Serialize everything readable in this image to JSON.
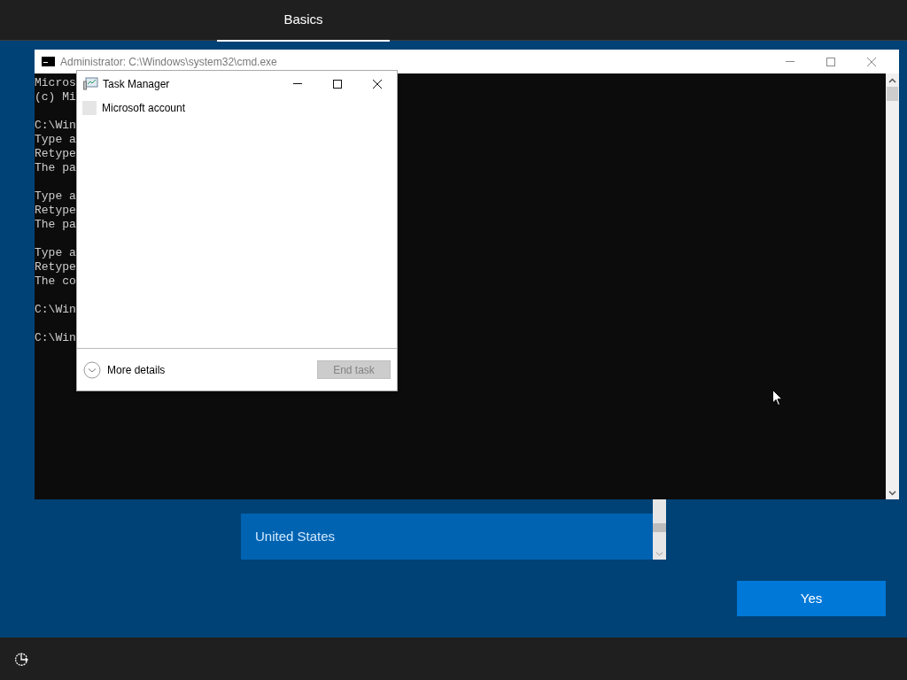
{
  "header": {
    "tabs": [
      {
        "label": "Basics",
        "selected": true
      }
    ]
  },
  "console_window": {
    "title": "Administrator: C:\\Windows\\system32\\cmd.exe",
    "blocks": [
      [
        "Micros",
        "(c) Mi"
      ],
      [
        "C:\\Win",
        "Type a",
        "Retype",
        "The pa"
      ],
      [
        "Type a",
        "Retype",
        "The pa"
      ],
      [
        "Type a",
        "Retype",
        "The co"
      ],
      [
        "C:\\Win"
      ],
      [
        "C:\\Win"
      ]
    ]
  },
  "task_manager": {
    "title": "Task Manager",
    "apps": [
      {
        "label": "Microsoft account"
      }
    ],
    "more_details": "More details",
    "end_task": {
      "label": "End task",
      "disabled": true
    }
  },
  "country_list": {
    "items": [
      {
        "label": "United States",
        "selected": true
      }
    ]
  },
  "yes_button": "Yes"
}
